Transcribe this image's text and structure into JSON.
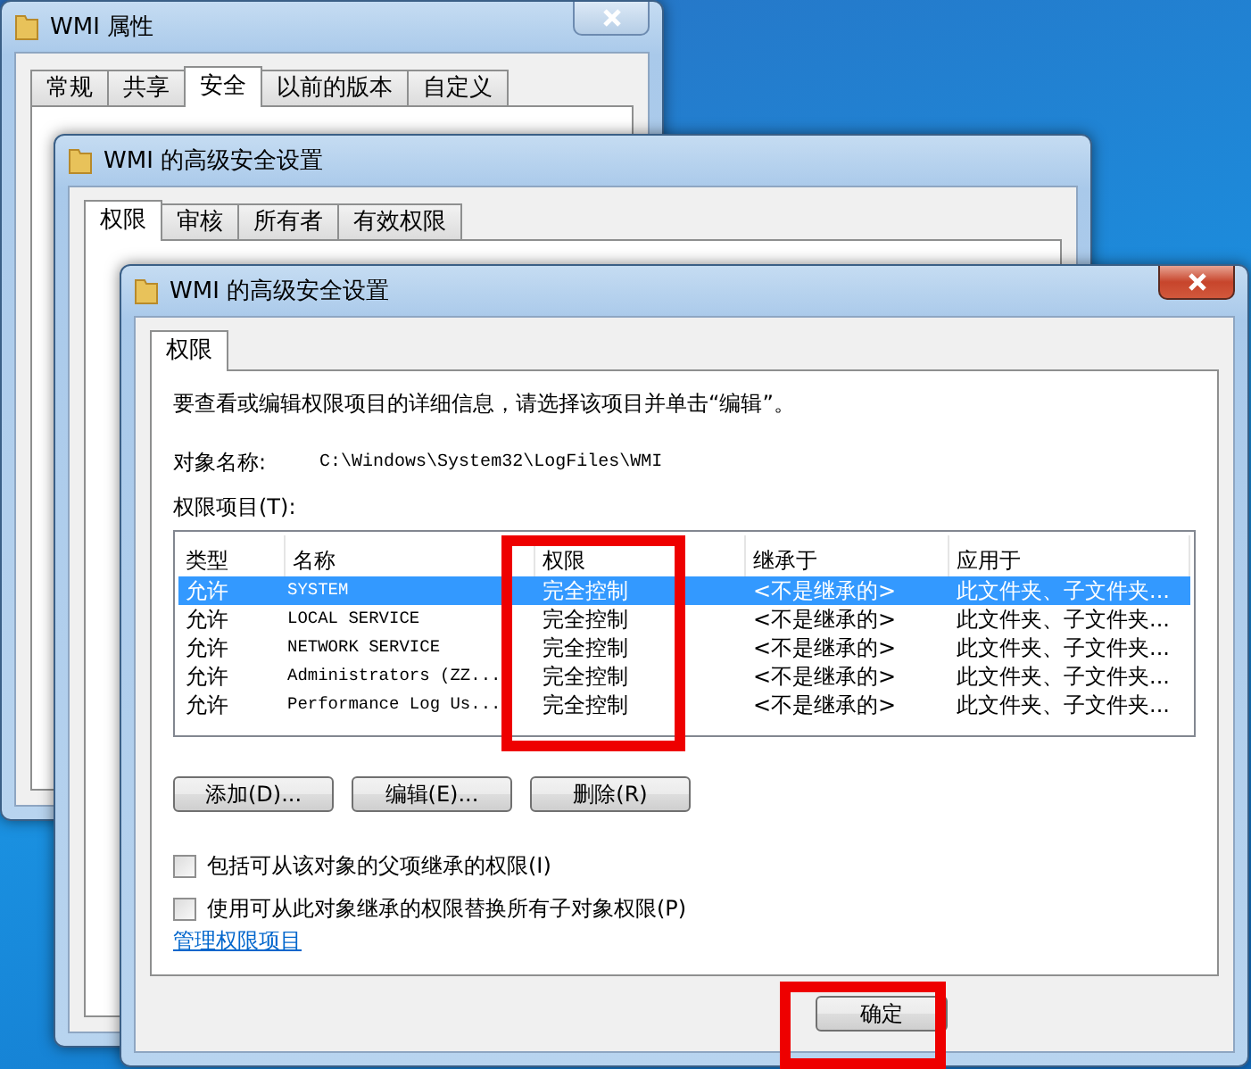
{
  "properties_window": {
    "title": "WMI 属性",
    "tabs": [
      {
        "label": "常规",
        "selected": false
      },
      {
        "label": "共享",
        "selected": false
      },
      {
        "label": "安全",
        "selected": true
      },
      {
        "label": "以前的版本",
        "selected": false
      },
      {
        "label": "自定义",
        "selected": false
      }
    ]
  },
  "back_advanced_window": {
    "title": "WMI 的高级安全设置",
    "tabs": [
      {
        "label": "权限",
        "selected": true
      },
      {
        "label": "审核",
        "selected": false
      },
      {
        "label": "所有者",
        "selected": false
      },
      {
        "label": "有效权限",
        "selected": false
      }
    ]
  },
  "advanced_window": {
    "title": "WMI 的高级安全设置",
    "tabs": [
      {
        "label": "权限",
        "selected": true
      }
    ],
    "instruction": "要查看或编辑权限项目的详细信息，请选择该项目并单击“编辑”。",
    "object_name_label": "对象名称:",
    "object_name": "C:\\Windows\\System32\\LogFiles\\WMI",
    "entries_label": "权限项目(T):",
    "columns": [
      "类型",
      "名称",
      "权限",
      "继承于",
      "应用于"
    ],
    "rows": [
      {
        "cells": [
          "允许",
          "SYSTEM",
          "完全控制",
          "<不是继承的>",
          "此文件夹、子文件夹..."
        ],
        "selected": true
      },
      {
        "cells": [
          "允许",
          "LOCAL SERVICE",
          "完全控制",
          "<不是继承的>",
          "此文件夹、子文件夹..."
        ],
        "selected": false
      },
      {
        "cells": [
          "允许",
          "NETWORK SERVICE",
          "完全控制",
          "<不是继承的>",
          "此文件夹、子文件夹..."
        ],
        "selected": false
      },
      {
        "cells": [
          "允许",
          "Administrators (ZZ...",
          "完全控制",
          "<不是继承的>",
          "此文件夹、子文件夹..."
        ],
        "selected": false
      },
      {
        "cells": [
          "允许",
          "Performance Log Us...",
          "完全控制",
          "<不是继承的>",
          "此文件夹、子文件夹..."
        ],
        "selected": false
      }
    ],
    "buttons": [
      "添加(D)...",
      "编辑(E)...",
      "删除(R)"
    ],
    "checkboxes": [
      {
        "label": "包括可从该对象的父项继承的权限(I)",
        "checked": false
      },
      {
        "label": "使用可从此对象继承的权限替换所有子对象权限(P)",
        "checked": false
      }
    ],
    "link": "管理权限项目",
    "ok_button": "确定"
  }
}
